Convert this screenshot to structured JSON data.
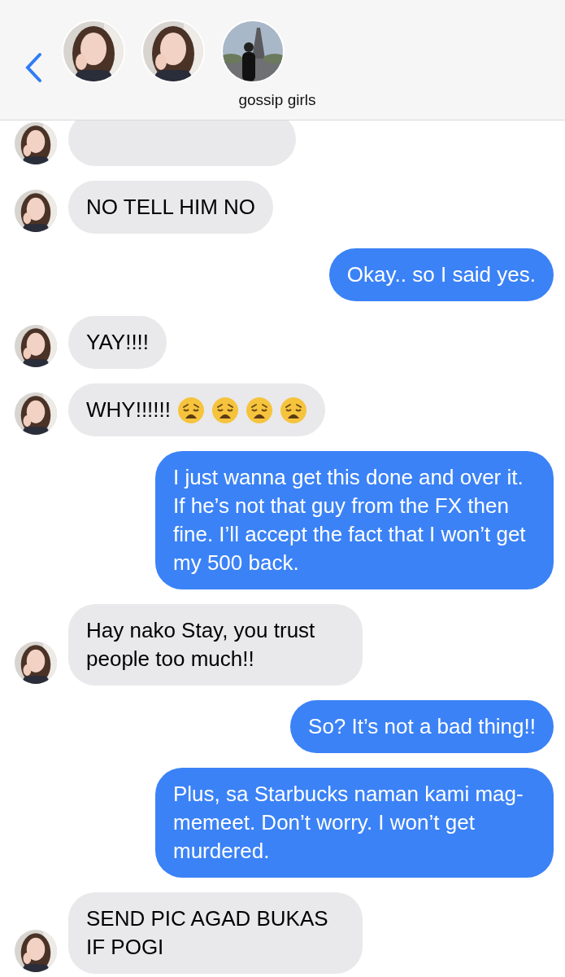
{
  "header": {
    "group_name": "gossip girls"
  },
  "messages": [
    {
      "kind": "received",
      "clipped": true
    },
    {
      "kind": "received",
      "text": "NO TELL HIM NO"
    },
    {
      "kind": "sent",
      "text": "Okay.. so I said yes."
    },
    {
      "kind": "received",
      "text": "YAY!!!!"
    },
    {
      "kind": "received",
      "text": "WHY!!!!!!",
      "emojis": [
        {
          "kind": "weary"
        },
        {
          "kind": "weary"
        },
        {
          "kind": "weary"
        },
        {
          "kind": "weary"
        }
      ]
    },
    {
      "kind": "sent",
      "text": "I just wanna get this done and over it. If he’s not that guy from the FX then fine. I’ll accept the fact that I won’t get my 500 back."
    },
    {
      "kind": "received",
      "text": "Hay nako Stay, you trust people too much!!"
    },
    {
      "kind": "sent",
      "text": "So? It’s not a bad thing!!"
    },
    {
      "kind": "sent",
      "text": "Plus, sa Starbucks naman kami mag-memeet. Don’t worry. I won’t get murdered."
    },
    {
      "kind": "received",
      "text": "SEND PIC AGAD BUKAS IF POGI"
    }
  ]
}
